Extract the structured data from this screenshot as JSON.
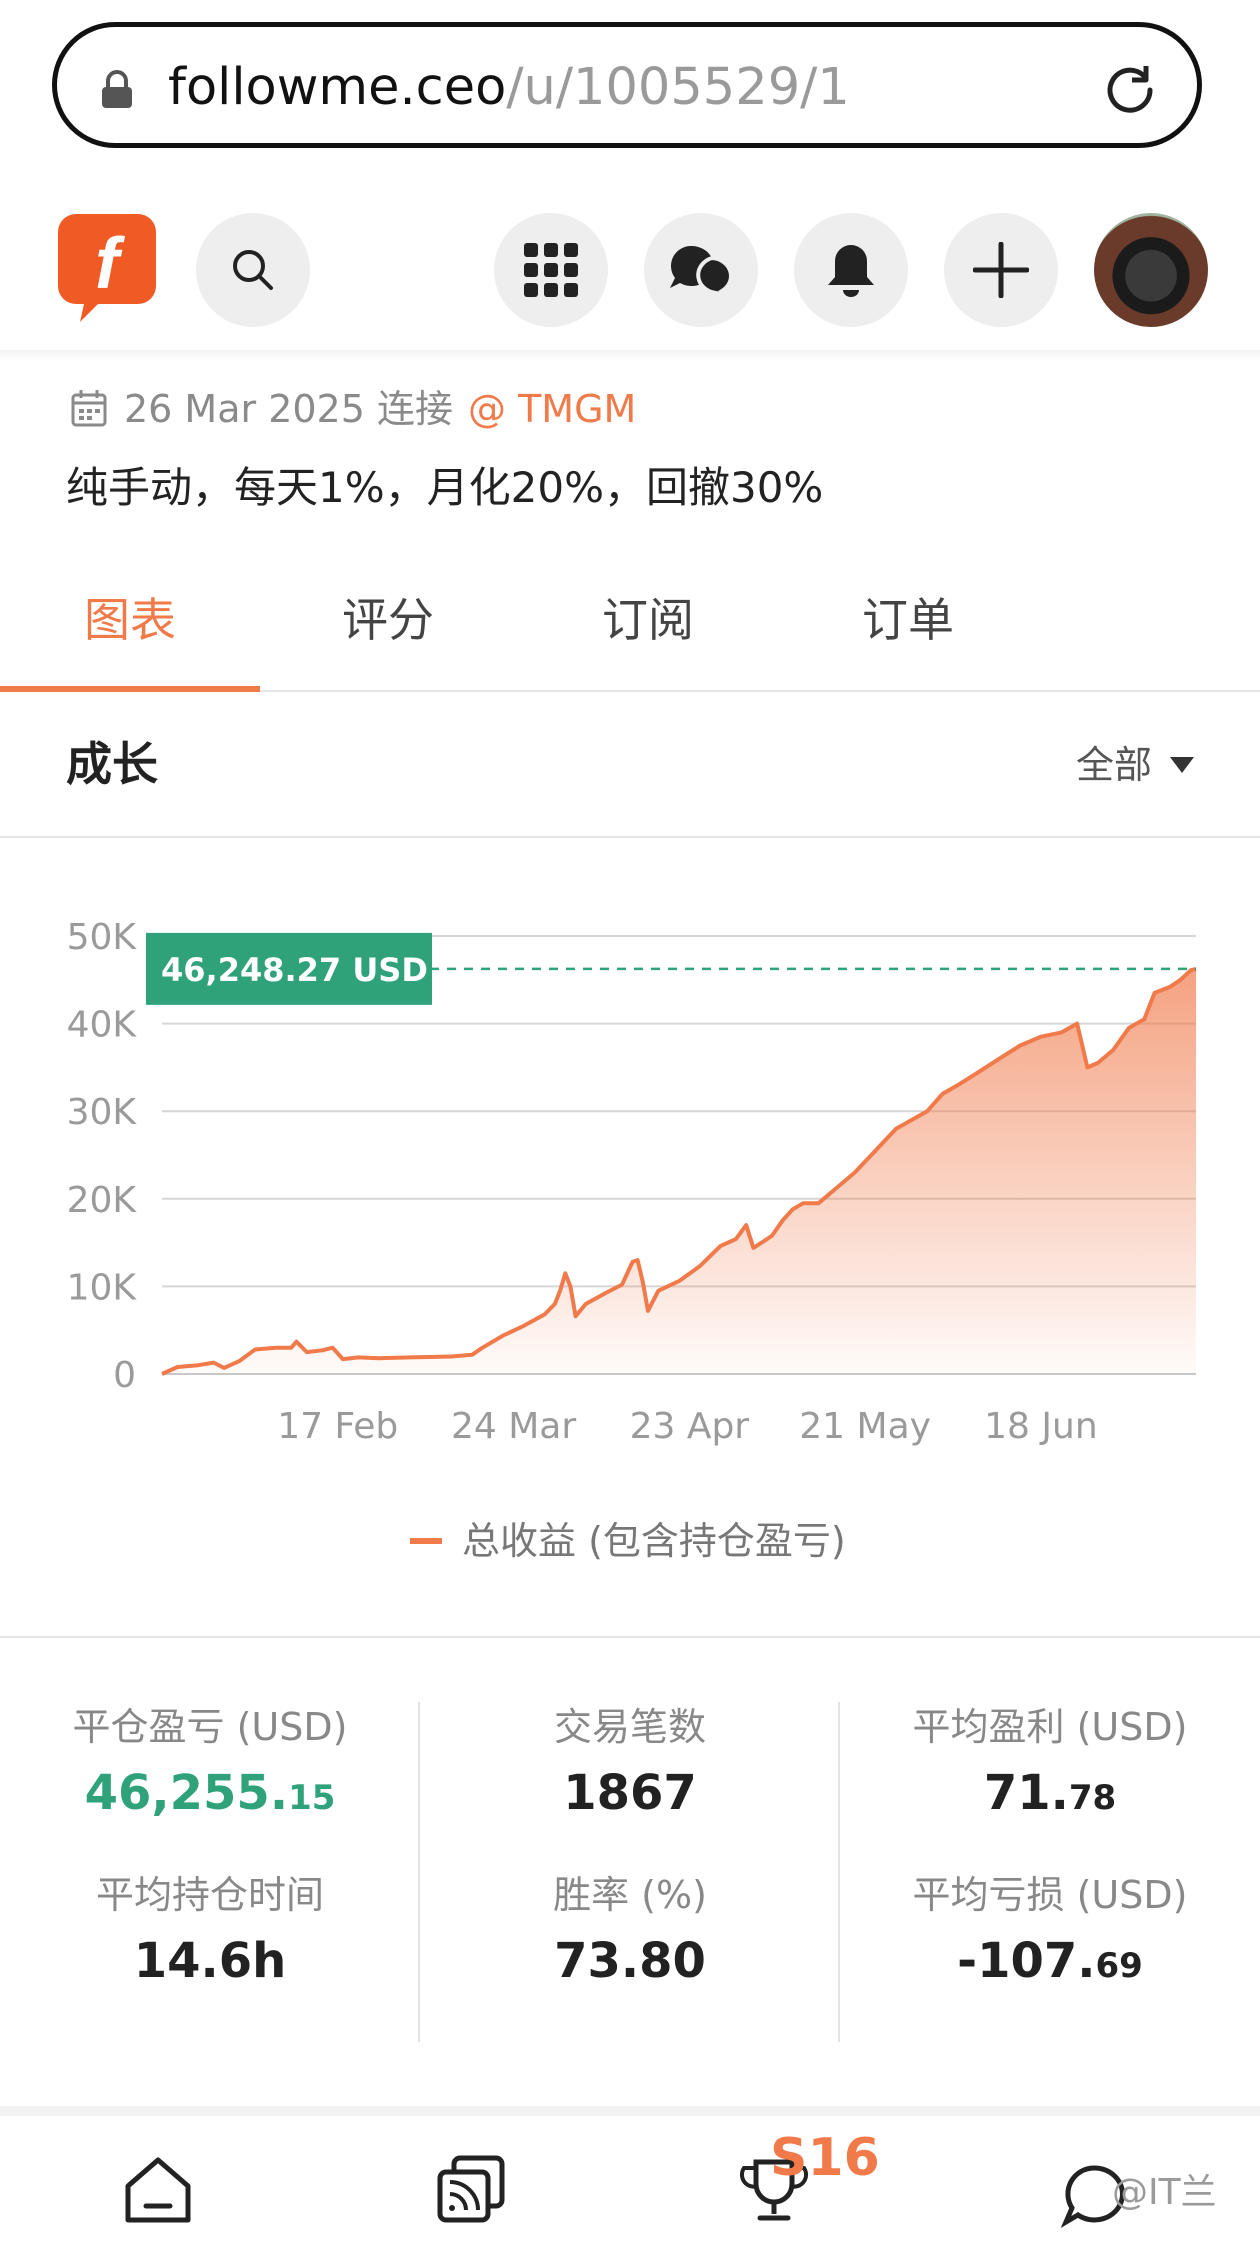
{
  "browser": {
    "url_host": "followme.ceo",
    "url_path": "/u/1005529/1",
    "icons": {
      "lock": "lock-icon",
      "reload": "reload-icon"
    }
  },
  "nav": {
    "logo_text": "f",
    "icons": [
      "search-icon",
      "apps-grid-icon",
      "chat-icon",
      "bell-icon",
      "plus-icon"
    ],
    "brand_color": "#f07a4a"
  },
  "profile": {
    "date_text": "26 Mar 2025 连接",
    "broker_text": "@ TMGM",
    "description": "纯手动，每天1%，月化20%，回撤30%"
  },
  "tabs": [
    {
      "label": "图表",
      "active": true
    },
    {
      "label": "评分",
      "active": false
    },
    {
      "label": "订阅",
      "active": false
    },
    {
      "label": "订单",
      "active": false
    }
  ],
  "section": {
    "title": "成长",
    "filter_label": "全部"
  },
  "chart_data": {
    "type": "area",
    "y_ticks": [
      "50K",
      "40K",
      "30K",
      "20K",
      "10K",
      "0"
    ],
    "ylim": [
      0,
      50000
    ],
    "x_ticks": [
      {
        "label": "17 Feb",
        "x": 0.17
      },
      {
        "label": "24 Mar",
        "x": 0.34
      },
      {
        "label": "23 Apr",
        "x": 0.51
      },
      {
        "label": "21 May",
        "x": 0.68
      },
      {
        "label": "18 Jun",
        "x": 0.85
      }
    ],
    "current_value_label": "46,248.27 USD",
    "current_value": 46248.27,
    "legend": "总收益 (包含持仓盈亏)",
    "series_color": "#f07a4a",
    "label_color": "#2fa27a",
    "points": [
      [
        0.0,
        0
      ],
      [
        0.015,
        800
      ],
      [
        0.035,
        1000
      ],
      [
        0.05,
        1300
      ],
      [
        0.06,
        700
      ],
      [
        0.075,
        1500
      ],
      [
        0.09,
        2800
      ],
      [
        0.11,
        3000
      ],
      [
        0.125,
        3000
      ],
      [
        0.13,
        3700
      ],
      [
        0.14,
        2500
      ],
      [
        0.155,
        2700
      ],
      [
        0.165,
        3000
      ],
      [
        0.175,
        1700
      ],
      [
        0.19,
        1900
      ],
      [
        0.21,
        1800
      ],
      [
        0.24,
        1900
      ],
      [
        0.28,
        2000
      ],
      [
        0.3,
        2200
      ],
      [
        0.31,
        3000
      ],
      [
        0.33,
        4400
      ],
      [
        0.35,
        5500
      ],
      [
        0.37,
        6800
      ],
      [
        0.38,
        8000
      ],
      [
        0.385,
        9500
      ],
      [
        0.39,
        11500
      ],
      [
        0.395,
        10000
      ],
      [
        0.4,
        6600
      ],
      [
        0.41,
        8000
      ],
      [
        0.43,
        9300
      ],
      [
        0.445,
        10200
      ],
      [
        0.455,
        12800
      ],
      [
        0.46,
        13000
      ],
      [
        0.465,
        10500
      ],
      [
        0.47,
        7200
      ],
      [
        0.48,
        9500
      ],
      [
        0.5,
        10600
      ],
      [
        0.52,
        12300
      ],
      [
        0.54,
        14600
      ],
      [
        0.555,
        15400
      ],
      [
        0.565,
        17000
      ],
      [
        0.572,
        14400
      ],
      [
        0.58,
        15000
      ],
      [
        0.59,
        15800
      ],
      [
        0.6,
        17500
      ],
      [
        0.61,
        18800
      ],
      [
        0.62,
        19500
      ],
      [
        0.635,
        19500
      ],
      [
        0.65,
        21000
      ],
      [
        0.67,
        23000
      ],
      [
        0.69,
        25500
      ],
      [
        0.71,
        28000
      ],
      [
        0.725,
        29000
      ],
      [
        0.74,
        30000
      ],
      [
        0.755,
        32000
      ],
      [
        0.77,
        33000
      ],
      [
        0.79,
        34500
      ],
      [
        0.81,
        36000
      ],
      [
        0.83,
        37500
      ],
      [
        0.85,
        38500
      ],
      [
        0.87,
        39000
      ],
      [
        0.885,
        40000
      ],
      [
        0.895,
        35000
      ],
      [
        0.905,
        35500
      ],
      [
        0.92,
        37000
      ],
      [
        0.935,
        39500
      ],
      [
        0.95,
        40500
      ],
      [
        0.96,
        43500
      ],
      [
        0.975,
        44200
      ],
      [
        0.985,
        45000
      ],
      [
        0.995,
        46100
      ],
      [
        1.0,
        46248
      ]
    ]
  },
  "stats": [
    {
      "label": "平仓盈亏 (USD)",
      "int": "46,255.",
      "dec": "15",
      "positive": true
    },
    {
      "label": "交易笔数",
      "int": "1867",
      "dec": ""
    },
    {
      "label": "平均盈利 (USD)",
      "int": "71.",
      "dec": "78"
    },
    {
      "label": "平均持仓时间",
      "int": "14.6h",
      "dec": ""
    },
    {
      "label": "胜率 (%)",
      "int": "73.80",
      "dec": ""
    },
    {
      "label": "平均亏损 (USD)",
      "int": "-107.",
      "dec": "69"
    }
  ],
  "bottom_bar": {
    "icons": [
      "home-icon",
      "feed-icon",
      "trophy-icon",
      "messages-icon"
    ],
    "badge": "S16",
    "watermark": "@IT兰"
  }
}
